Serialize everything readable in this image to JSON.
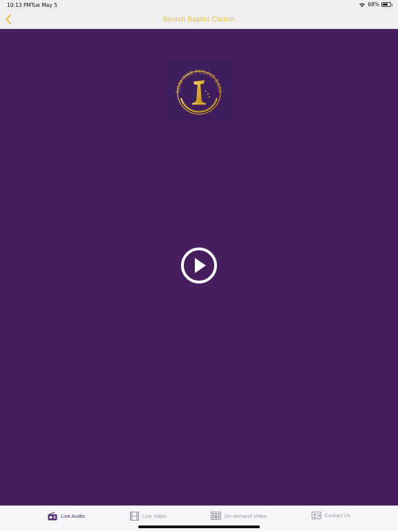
{
  "status_bar": {
    "time": "10:13 PM",
    "date": "Tue May 5",
    "battery": "68%",
    "battery_level": 0.68,
    "icons": [
      "wifi-icon",
      "battery-icon"
    ]
  },
  "nav": {
    "title": "Beulah Baptist Church",
    "back_icon": "chevron-left-icon"
  },
  "logo": {
    "text": "FROM THE PULPIT RADIO",
    "icon": "pulpit-logo"
  },
  "player": {
    "icon": "play-icon"
  },
  "tabs": [
    {
      "label": "Live Audio",
      "icon": "radio-icon",
      "active": true
    },
    {
      "label": "Live Video",
      "icon": "film-icon",
      "active": false
    },
    {
      "label": "On-demand Video",
      "icon": "video-grid-icon",
      "active": false
    },
    {
      "label": "Contact Us",
      "icon": "contact-card-icon",
      "active": false
    }
  ],
  "colors": {
    "accent": "#e8c43a",
    "background": "#461e5e",
    "tab_active": "#4f2a74",
    "tab_inactive": "#9a9a9f"
  }
}
